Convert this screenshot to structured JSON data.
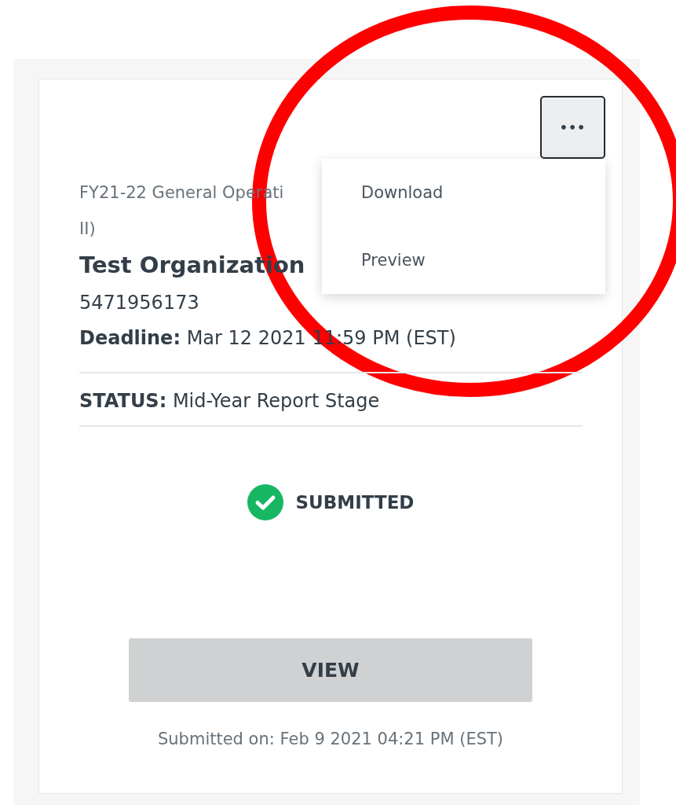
{
  "card": {
    "more_button": {
      "label": "•••"
    },
    "title_lines": [
      "FY21-22 General Operati",
      "II)"
    ],
    "organization": "Test Organization",
    "number": "5471956173",
    "deadline": {
      "label": "Deadline:",
      "value": "Mar 12 2021 11:59 PM (EST)"
    },
    "status": {
      "label": "STATUS:",
      "value": "Mid-Year Report Stage"
    },
    "submission": {
      "done": true,
      "text": "SUBMITTED"
    },
    "view_button": {
      "label": "VIEW"
    },
    "submitted_on": "Submitted on: Feb 9 2021 04:21 PM (EST)"
  },
  "menu": {
    "open": true,
    "items": [
      {
        "label": "Download"
      },
      {
        "label": "Preview"
      }
    ]
  },
  "annotation": {
    "kind": "ellipse",
    "color": "#ff0000"
  }
}
